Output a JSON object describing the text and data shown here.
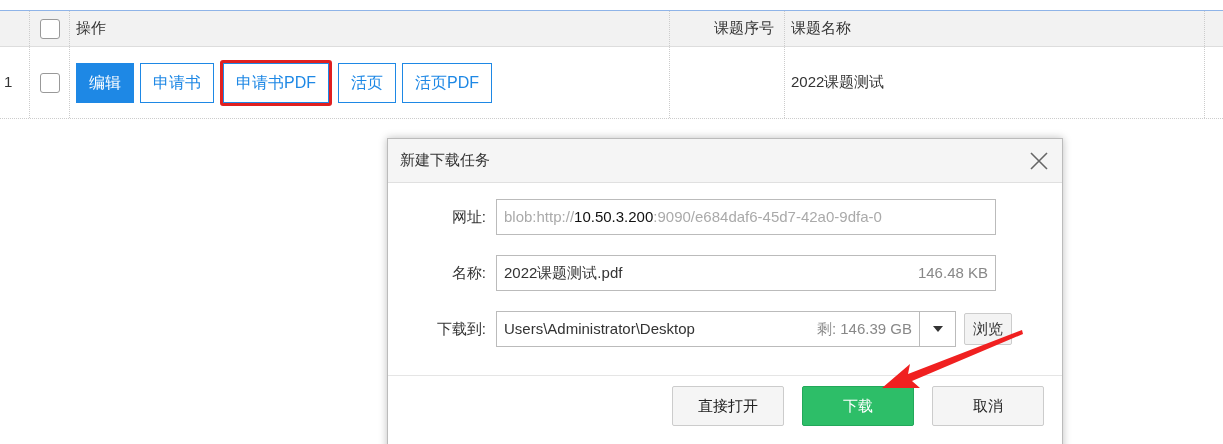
{
  "table": {
    "columns": [
      {
        "label": "操作"
      },
      {
        "label": "课题序号"
      },
      {
        "label": "课题名称"
      }
    ],
    "header_checked": false,
    "rows": [
      {
        "number": "1",
        "checked": false,
        "actions": [
          {
            "label": "编辑",
            "kind": "primary",
            "highlighted": false
          },
          {
            "label": "申请书",
            "kind": "outline",
            "highlighted": false
          },
          {
            "label": "申请书PDF",
            "kind": "outline",
            "highlighted": true
          },
          {
            "label": "活页",
            "kind": "outline",
            "highlighted": false
          },
          {
            "label": "活页PDF",
            "kind": "outline",
            "highlighted": false
          }
        ],
        "serial": "",
        "name": "2022课题测试"
      }
    ]
  },
  "dialog": {
    "title": "新建下载任务",
    "url": {
      "label": "网址:",
      "prefix": "blob:http://",
      "host": "10.50.3.200",
      "suffix": ":9090/e684daf6-45d7-42a0-9dfa-0"
    },
    "name": {
      "label": "名称:",
      "value": "2022课题测试.pdf",
      "size": "146.48 KB"
    },
    "save_to": {
      "label": "下载到:",
      "path": "Users\\Administrator\\Desktop",
      "free": "剩: 146.39 GB",
      "browse": "浏览"
    },
    "buttons": [
      {
        "label": "直接打开",
        "kind": "default"
      },
      {
        "label": "下载",
        "kind": "primary"
      },
      {
        "label": "取消",
        "kind": "default"
      }
    ]
  }
}
